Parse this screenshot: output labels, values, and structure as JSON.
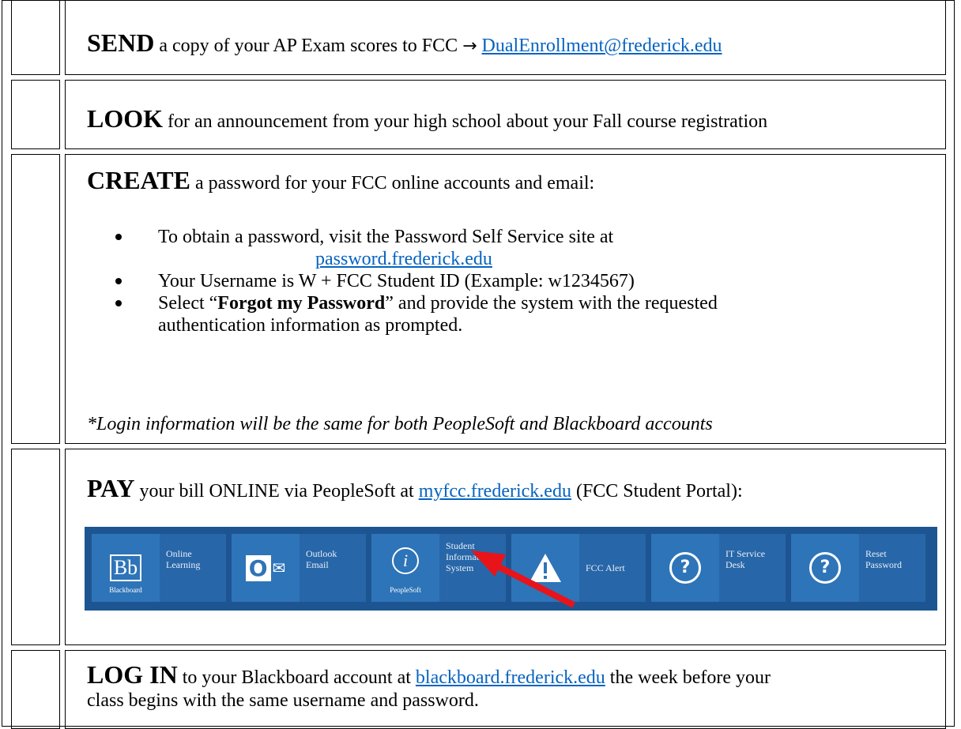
{
  "rows": [
    {
      "keyword": "SEND",
      "text": " a copy of your AP Exam scores to FCC ",
      "arrow": "→",
      "link": "DualEnrollment@frederick.edu"
    },
    {
      "keyword": "LOOK",
      "text": " for an announcement from your high school about your Fall course registration"
    },
    {
      "keyword": "CREATE",
      "text": " a password for your FCC online accounts and email:",
      "bullets": [
        {
          "line1": "To obtain a password, visit the Password Self Service site at",
          "link": "password.frederick.edu"
        },
        {
          "line1": "Your Username is W + FCC Student ID (Example: w1234567)"
        },
        {
          "pre": "Select “",
          "bold": "Forgot my Password",
          "post": "” and provide the system with the requested",
          "line2": "authentication information as prompted."
        }
      ],
      "note": "*Login information will be the same for both PeopleSoft and Blackboard accounts"
    },
    {
      "keyword": "PAY",
      "text": " your bill ONLINE via PeopleSoft at ",
      "link": "myfcc.frederick.edu",
      "text2": " (FCC Student Portal):"
    },
    {
      "keyword": "LOG IN",
      "text": " to your Blackboard account at ",
      "link": "blackboard.frederick.edu",
      "text2": " the week before your",
      "line2": "class begins with the same username and password."
    }
  ],
  "portal": {
    "tiles": [
      {
        "icon": "Bb",
        "icon_sub": "Blackboard",
        "label1": "Online",
        "label2": "Learning"
      },
      {
        "icon": "O",
        "label1": "Outlook",
        "label2": "Email"
      },
      {
        "icon": "i",
        "icon_sub": "PeopleSoft",
        "label1": "Student",
        "label2": "Information",
        "label3": "System"
      },
      {
        "icon": "!",
        "label1": "FCC Alert",
        "label2": ""
      },
      {
        "icon": "?",
        "label1": "IT Service",
        "label2": "Desk"
      },
      {
        "icon": "?",
        "label1": "Reset",
        "label2": "Password"
      }
    ]
  },
  "colors": {
    "link": "#0563c1",
    "portal_bg": "#1d5592",
    "tile": "#2766a8",
    "arrow": "#e8141a"
  }
}
